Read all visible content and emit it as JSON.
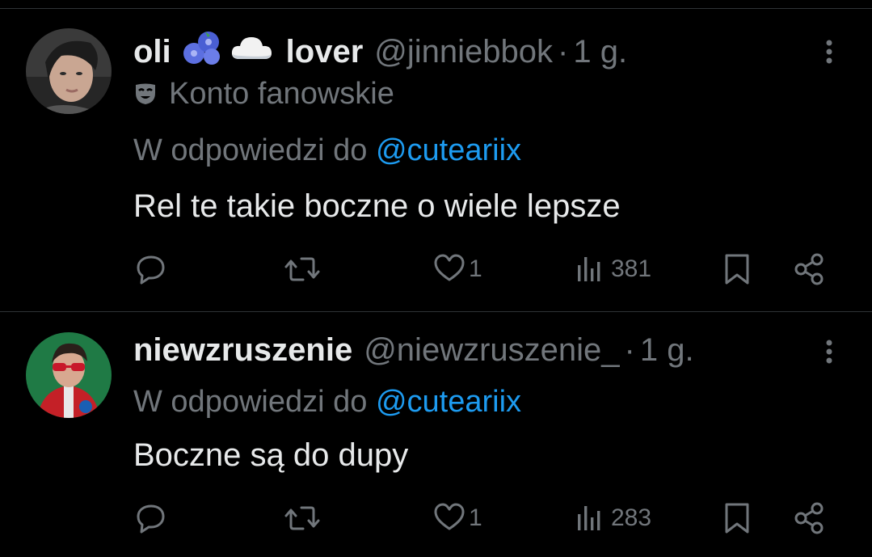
{
  "colors": {
    "background": "#000000",
    "text": "#e7e9ea",
    "muted": "#71767b",
    "accent": "#1d9bf0",
    "divider": "#2f3336"
  },
  "tweets": [
    {
      "name_part1": "oli",
      "name_emojis": [
        "blueberries-emoji",
        "cloud-emoji"
      ],
      "name_part2": "lover",
      "handle": "@jinniebbok",
      "separator": "·",
      "time": "1 g.",
      "badge": "Konto fanowskie",
      "reply_prefix": "W odpowiedzi do",
      "reply_to": "@cuteariix",
      "text": "Rel te takie boczne o wiele lepsze",
      "likes": "1",
      "views": "381"
    },
    {
      "name": "niewzruszenie",
      "handle": "@niewzruszenie_",
      "separator": "·",
      "time": "1 g.",
      "reply_prefix": "W odpowiedzi do",
      "reply_to": "@cuteariix",
      "text": "Boczne są do dupy",
      "likes": "1",
      "views": "283"
    }
  ]
}
